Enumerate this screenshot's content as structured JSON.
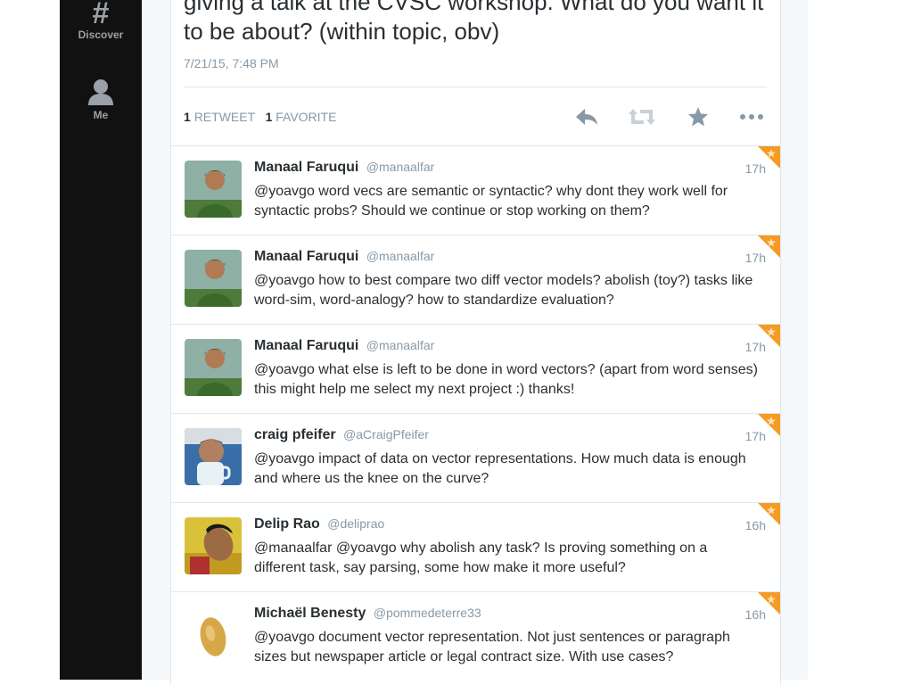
{
  "sidebar": {
    "discover_label": "Discover",
    "me_label": "Me"
  },
  "tweet": {
    "text": "giving a talk at the CVSC workshop. What do you want it to be about? (within topic, obv)",
    "timestamp": "7/21/15, 7:48 PM",
    "retweet_count": "1",
    "retweet_label": "RETWEET",
    "favorite_count": "1",
    "favorite_label": "FAVORITE"
  },
  "colors": {
    "sidebar_bg": "#111111",
    "accent_corner": "#f59a23",
    "muted": "#8899a6",
    "text": "#292f33"
  },
  "replies": [
    {
      "name": "Manaal Faruqui",
      "handle": "@manaalfar",
      "time": "17h",
      "text": "@yoavgo word vecs are semantic or syntactic? why dont they work well for syntactic probs? Should we continue or stop working on them?",
      "avatar": "manaal-avatar"
    },
    {
      "name": "Manaal Faruqui",
      "handle": "@manaalfar",
      "time": "17h",
      "text": "@yoavgo how to best compare two diff vector models? abolish (toy?) tasks like word-sim, word-analogy? how to standardize evaluation?",
      "avatar": "manaal-avatar"
    },
    {
      "name": "Manaal Faruqui",
      "handle": "@manaalfar",
      "time": "17h",
      "text": "@yoavgo what else is left to be done in word vectors? (apart from word senses) this might help me select my next project :) thanks!",
      "avatar": "manaal-avatar"
    },
    {
      "name": "craig pfeifer",
      "handle": "@aCraigPfeifer",
      "time": "17h",
      "text": "@yoavgo impact of data on vector representations. How much data is enough and where us the knee on the curve?",
      "avatar": "craig-avatar"
    },
    {
      "name": "Delip Rao",
      "handle": "@deliprao",
      "time": "16h",
      "text": "@manaalfar @yoavgo why abolish any task? Is proving something on a different task, say parsing, some how make it more useful?",
      "avatar": "delip-avatar"
    },
    {
      "name": "Michaël Benesty",
      "handle": "@pommedeterre33",
      "time": "16h",
      "text": "@yoavgo document vector representation. Not just sentences or paragraph sizes but newspaper article or legal contract size. With use cases?",
      "avatar": "potato-avatar"
    }
  ]
}
